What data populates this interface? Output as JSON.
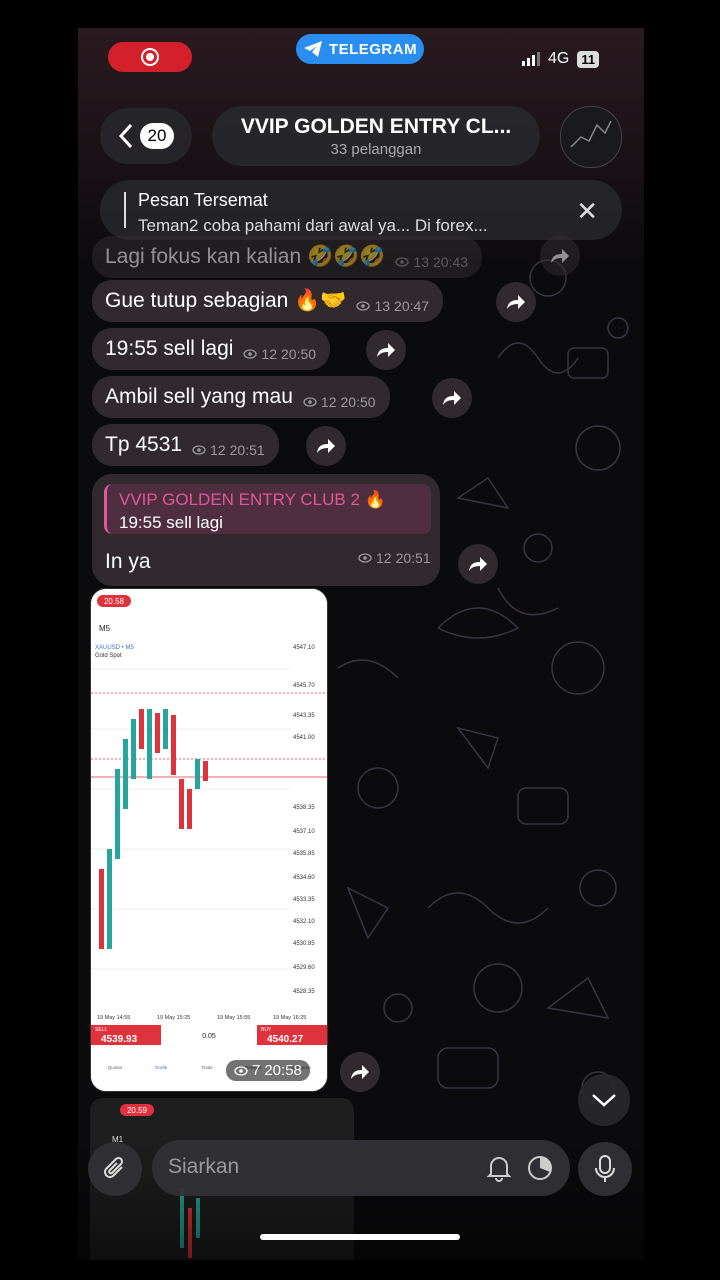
{
  "status": {
    "app_pill": "TELEGRAM",
    "network": "4G",
    "battery": "11"
  },
  "header": {
    "back_count": "20",
    "title": "VVIP GOLDEN ENTRY CL...",
    "subtitle": "33 pelanggan"
  },
  "pinned": {
    "heading": "Pesan Tersemat",
    "text": "Teman2 coba pahami dari awal ya... Di forex..."
  },
  "messages": [
    {
      "text": "Lagi fokus kan kalian 🤣🤣🤣",
      "views": "13",
      "time": "20:43"
    },
    {
      "text": "Gue tutup sebagian 🔥🤝",
      "views": "13",
      "time": "20:47"
    },
    {
      "text": "19:55 sell lagi",
      "views": "12",
      "time": "20:50"
    },
    {
      "text": "Ambil sell yang mau",
      "views": "12",
      "time": "20:50"
    },
    {
      "text": "Tp 4531",
      "views": "12",
      "time": "20:51"
    }
  ],
  "reply_message": {
    "quote_name": "VVIP GOLDEN ENTRY CLUB 2 🔥",
    "quote_text": "19:55 sell lagi",
    "text": "In ya",
    "views": "12",
    "time": "20:51"
  },
  "screenshot": {
    "status_time": "20.58",
    "timeframe": "M5",
    "symbol": "XAUUSD • M5",
    "subtitle": "Gold Spot",
    "price_ticks": [
      "4547.10",
      "4545.70",
      "4543.35",
      "4541.00",
      "4538.35",
      "4537.10",
      "4535.85",
      "4534.60",
      "4533.35",
      "4532.10",
      "4530.85",
      "4529.60",
      "4528.35"
    ],
    "dates": [
      "19 May 14:55",
      "19 May 15:25",
      "19 May 15:55",
      "19 May 16:25"
    ],
    "sell_label": "SELL",
    "sell_price": "4539.93",
    "lot": "0.05",
    "buy_label": "BUY",
    "buy_price": "4540.27",
    "nav": [
      "Quotes",
      "Grafik",
      "Trade",
      "Riwayat",
      "Pengaturan"
    ],
    "views": "7",
    "time": "20:58"
  },
  "screenshot2": {
    "status_time": "20.59",
    "timeframe": "M1"
  },
  "composer": {
    "placeholder": "Siarkan"
  },
  "colors": {
    "accent_pink": "#e0579a",
    "telegram_blue": "#2a8df0",
    "record_red": "#d3202a"
  },
  "icons": [
    "record-icon",
    "telegram-icon",
    "back-chevron-icon",
    "close-icon",
    "eye-icon",
    "forward-icon",
    "chevron-down-icon",
    "paperclip-icon",
    "bell-icon",
    "timer-icon",
    "mic-icon"
  ]
}
